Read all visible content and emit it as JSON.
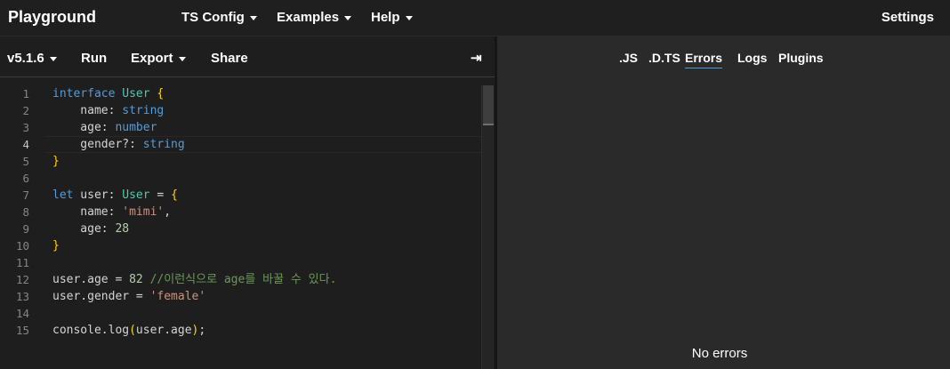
{
  "topnav": {
    "brand": "Playground",
    "menus": [
      {
        "label": "TS Config"
      },
      {
        "label": "Examples"
      },
      {
        "label": "Help"
      }
    ],
    "settings": "Settings"
  },
  "toolbar": {
    "version": "v5.1.6",
    "run": "Run",
    "export": "Export",
    "share": "Share",
    "collapse_glyph": "⇥"
  },
  "editor": {
    "active_line": 4,
    "line_numbers": [
      "1",
      "2",
      "3",
      "4",
      "5",
      "6",
      "7",
      "8",
      "9",
      "10",
      "11",
      "12",
      "13",
      "14",
      "15"
    ],
    "lines": [
      [
        {
          "t": "interface",
          "c": "kw"
        },
        {
          "t": " ",
          "c": "pl"
        },
        {
          "t": "User",
          "c": "ty"
        },
        {
          "t": " ",
          "c": "pl"
        },
        {
          "t": "{",
          "c": "br"
        }
      ],
      [
        {
          "t": "    name: ",
          "c": "pl"
        },
        {
          "t": "string",
          "c": "kw"
        }
      ],
      [
        {
          "t": "    age: ",
          "c": "pl"
        },
        {
          "t": "number",
          "c": "kw"
        }
      ],
      [
        {
          "t": "    gender?: ",
          "c": "pl"
        },
        {
          "t": "string",
          "c": "kw"
        }
      ],
      [
        {
          "t": "}",
          "c": "br"
        }
      ],
      [],
      [
        {
          "t": "let",
          "c": "kw"
        },
        {
          "t": " user: ",
          "c": "pl"
        },
        {
          "t": "User",
          "c": "ty"
        },
        {
          "t": " = ",
          "c": "pl"
        },
        {
          "t": "{",
          "c": "br"
        }
      ],
      [
        {
          "t": "    name: ",
          "c": "pl"
        },
        {
          "t": "'mimi'",
          "c": "st"
        },
        {
          "t": ",",
          "c": "pl"
        }
      ],
      [
        {
          "t": "    age: ",
          "c": "pl"
        },
        {
          "t": "28",
          "c": "nu"
        }
      ],
      [
        {
          "t": "}",
          "c": "br"
        }
      ],
      [],
      [
        {
          "t": "user.age = ",
          "c": "pl"
        },
        {
          "t": "82",
          "c": "nu"
        },
        {
          "t": " ",
          "c": "pl"
        },
        {
          "t": "//이런식으로 age를 바꿀 수 있다.",
          "c": "cm"
        }
      ],
      [
        {
          "t": "user.gender = ",
          "c": "pl"
        },
        {
          "t": "'female'",
          "c": "st"
        }
      ],
      [],
      [
        {
          "t": "console.log",
          "c": "pl"
        },
        {
          "t": "(",
          "c": "br"
        },
        {
          "t": "user.age",
          "c": "pl"
        },
        {
          "t": ")",
          "c": "br"
        },
        {
          "t": ";",
          "c": "pl"
        }
      ]
    ]
  },
  "output": {
    "tabs": [
      {
        "label": ".JS",
        "active": false
      },
      {
        "label": ".D.TS",
        "active": false
      },
      {
        "label": "Errors",
        "active": true
      },
      {
        "label": "Logs",
        "active": false
      },
      {
        "label": "Plugins",
        "active": false
      }
    ],
    "message": "No errors"
  },
  "colors": {
    "keyword": "#569cd6",
    "type": "#4ec9b0",
    "bracket": "#ffd700",
    "string": "#ce9178",
    "number": "#b5cea8",
    "comment": "#6a9955",
    "active_tab_underline": "#4a9edb"
  }
}
